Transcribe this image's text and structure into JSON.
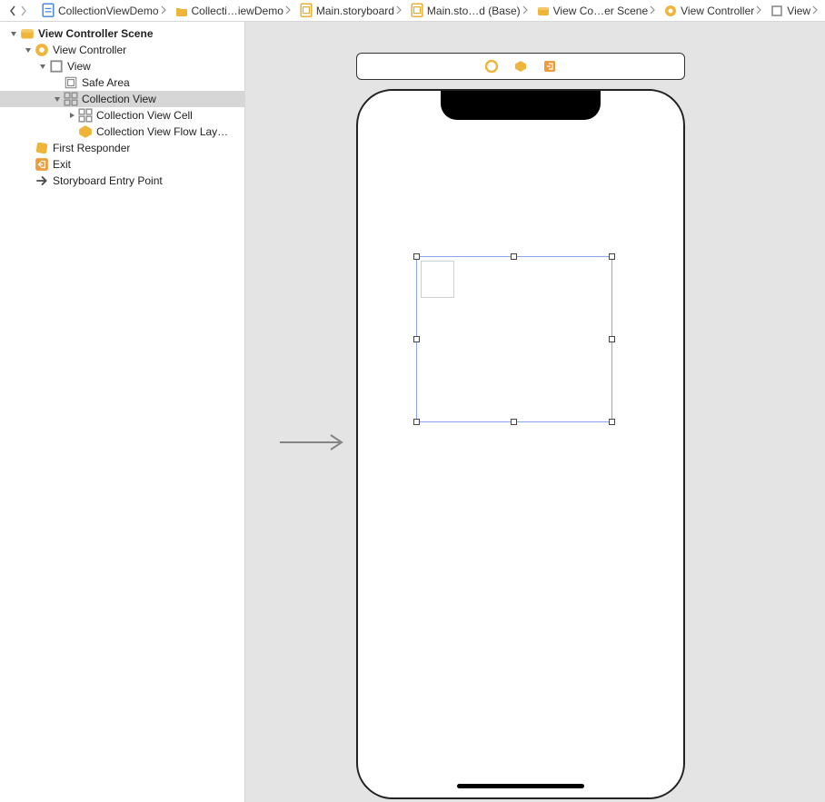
{
  "breadcrumbs": [
    {
      "icon": "file-blue",
      "label": "CollectionViewDemo"
    },
    {
      "icon": "folder-amber",
      "label": "Collecti…iewDemo"
    },
    {
      "icon": "file-amber",
      "label": "Main.storyboard"
    },
    {
      "icon": "file-amber",
      "label": "Main.sto…d (Base)"
    },
    {
      "icon": "scene-amber",
      "label": "View Co…er Scene"
    },
    {
      "icon": "circle-amber",
      "label": "View Controller"
    },
    {
      "icon": "square-gray",
      "label": "View"
    }
  ],
  "outline": {
    "scene": "View Controller Scene",
    "controller": "View Controller",
    "view": "View",
    "safe_area": "Safe Area",
    "collection_view": "Collection View",
    "cell": "Collection View Cell",
    "flow": "Collection View Flow Lay…",
    "first_responder": "First Responder",
    "exit": "Exit",
    "entry": "Storyboard Entry Point"
  },
  "colors": {
    "accent_amber": "#efb43a",
    "selection_gray": "#d6d6d6",
    "selection_blue": "#8aa3f4"
  }
}
